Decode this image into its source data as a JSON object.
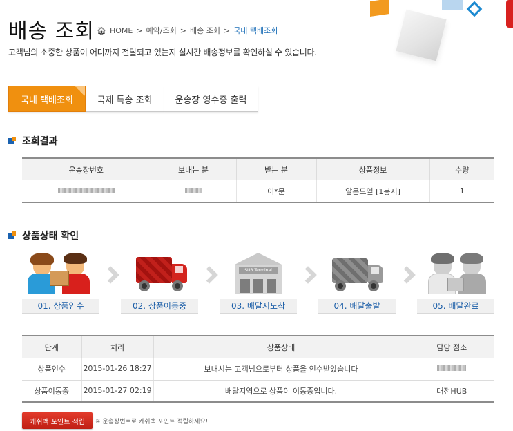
{
  "header": {
    "title": "배송 조회",
    "breadcrumb": [
      "HOME",
      "예약/조회",
      "배송 조회",
      "국내 택배조회"
    ],
    "subtitle": "고객님의 소중한 상품이 어디까지 전달되고 있는지 실시간 배송정보를 확인하실 수 있습니다."
  },
  "tabs": [
    {
      "label": "국내 택배조회",
      "active": true
    },
    {
      "label": "국제 특송 조회",
      "active": false
    },
    {
      "label": "운송장 영수증 출력",
      "active": false
    }
  ],
  "result": {
    "section_title": "조회결과",
    "columns": [
      "운송장번호",
      "보내는 분",
      "받는 분",
      "상품정보",
      "수량"
    ],
    "row": {
      "tracking_no": "",
      "sender": "",
      "receiver": "이*문",
      "product": "알몬드잎 [1봉지]",
      "quantity": "1"
    }
  },
  "status": {
    "section_title": "상품상태 확인",
    "steps": [
      {
        "label": "01. 상품인수",
        "icon": "handover-people-icon",
        "active": true
      },
      {
        "label": "02. 상품이동중",
        "icon": "red-truck-icon",
        "active": true
      },
      {
        "label": "03. 배달지도착",
        "icon": "terminal-building-icon",
        "terminal_text": "SUB Terminal",
        "active": false
      },
      {
        "label": "04. 배달출발",
        "icon": "grey-truck-icon",
        "active": false
      },
      {
        "label": "05. 배달완료",
        "icon": "delivered-people-icon",
        "active": false
      }
    ]
  },
  "history": {
    "columns": [
      "단계",
      "처리",
      "상품상태",
      "담당 점소"
    ],
    "rows": [
      {
        "stage": "상품인수",
        "time": "2015-01-26 18:27",
        "status": "보내시는 고객님으로부터 상품을 인수받았습니다",
        "branch": ""
      },
      {
        "stage": "상품이동중",
        "time": "2015-01-27 02:19",
        "status": "배달지역으로 상품이 이동중입니다.",
        "branch": "대전HUB"
      }
    ]
  },
  "footer": {
    "button_label": "캐쉬백 포인트 적립",
    "note": "※ 운송장번호로 캐쉬백 포인트 적립하세요!"
  },
  "colors": {
    "accent": "#f0900f",
    "brand_blue": "#1a62b0",
    "button_red": "#d42a1e"
  }
}
